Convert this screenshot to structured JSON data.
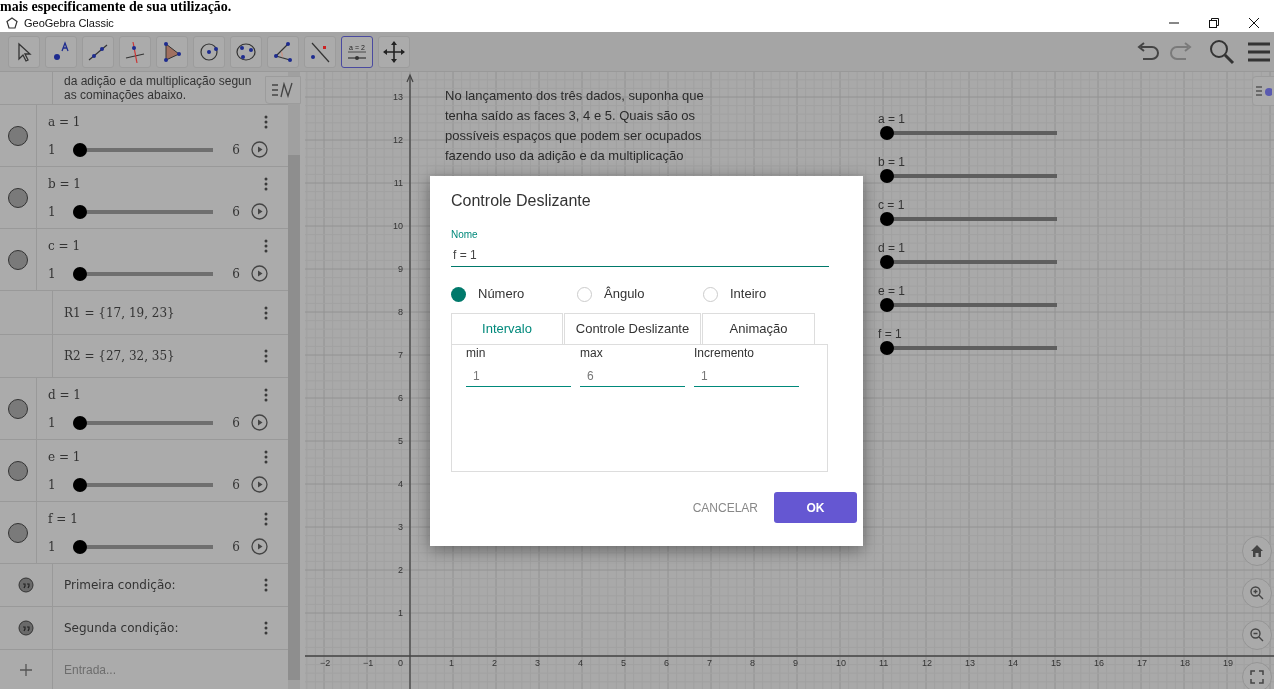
{
  "page_heading": "mais especificamente de sua utilização.",
  "window": {
    "title": "GeoGebra Classic"
  },
  "toolbar": {
    "tools": [
      {
        "kind": "move",
        "selected": false
      },
      {
        "kind": "point",
        "selected": false
      },
      {
        "kind": "line",
        "selected": false
      },
      {
        "kind": "perpendicular",
        "selected": false
      },
      {
        "kind": "polygon",
        "selected": false
      },
      {
        "kind": "circle",
        "selected": false
      },
      {
        "kind": "conic",
        "selected": false
      },
      {
        "kind": "angle",
        "selected": false
      },
      {
        "kind": "reflect",
        "selected": false
      },
      {
        "kind": "slider",
        "label": "a = 2",
        "selected": true
      },
      {
        "kind": "pan",
        "selected": false
      }
    ]
  },
  "algebra": {
    "top_text": [
      "da adição e da multiplicação segun",
      "as cominações abaixo."
    ],
    "items": [
      {
        "kind": "slider",
        "label": "a = 1",
        "min": "1",
        "max": "6",
        "level": 0
      },
      {
        "kind": "slider",
        "label": "b = 1",
        "min": "1",
        "max": "6",
        "level": 0
      },
      {
        "kind": "slider",
        "label": "c = 1",
        "min": "1",
        "max": "6",
        "level": 0
      },
      {
        "kind": "value",
        "label": "R1 = {17, 19, 23}"
      },
      {
        "kind": "value",
        "label": "R2 = {27, 32, 35}"
      },
      {
        "kind": "slider",
        "label": "d = 1",
        "min": "1",
        "max": "6",
        "level": 0
      },
      {
        "kind": "slider",
        "label": "e = 1",
        "min": "1",
        "max": "6",
        "level": 0
      },
      {
        "kind": "slider",
        "label": "f = 1",
        "min": "1",
        "max": "6",
        "level": 0
      },
      {
        "kind": "text",
        "label": "Primeira condição:"
      },
      {
        "kind": "text",
        "label": "Segunda condição:"
      }
    ],
    "input": {
      "placeholder": "Entrada..."
    }
  },
  "graphics": {
    "text_lines": [
      "No lançamento dos três dados, suponha que",
      "tenha saído as faces 3, 4 e 5. Quais são os",
      "possíveis espaços que podem ser ocupados",
      "fazendo uso da adição e da multiplicação"
    ],
    "sliders": [
      {
        "label": "a = 1",
        "level": 0
      },
      {
        "label": "b = 1",
        "level": 0
      },
      {
        "label": "c = 1",
        "level": 0
      },
      {
        "label": "d = 1",
        "level": 0
      },
      {
        "label": "e = 1",
        "level": 0
      },
      {
        "label": "f = 1",
        "level": 0
      }
    ],
    "x_labels": [
      "−2",
      "−1",
      "0",
      "1",
      "2",
      "3",
      "4",
      "5",
      "6",
      "7",
      "8",
      "9",
      "10",
      "11",
      "12",
      "13",
      "14",
      "15",
      "16",
      "17",
      "18",
      "19"
    ],
    "y_labels": [
      "13",
      "12",
      "11",
      "10",
      "9",
      "8",
      "7",
      "6",
      "5",
      "4",
      "3",
      "2",
      "1"
    ]
  },
  "dialog": {
    "title": "Controle Deslizante",
    "name_label": "Nome",
    "name_value": "f = 1",
    "types": [
      {
        "label": "Número",
        "selected": true
      },
      {
        "label": "Ângulo",
        "selected": false
      },
      {
        "label": "Inteiro",
        "selected": false
      }
    ],
    "tabs": [
      {
        "label": "Intervalo",
        "selected": true
      },
      {
        "label": "Controle Deslizante",
        "selected": false
      },
      {
        "label": "Animação",
        "selected": false
      }
    ],
    "fields": [
      {
        "label": "min",
        "value": "1"
      },
      {
        "label": "max",
        "value": "6"
      },
      {
        "label": "Incremento",
        "value": "1"
      }
    ],
    "cancel": "CANCELAR",
    "ok": "OK"
  }
}
